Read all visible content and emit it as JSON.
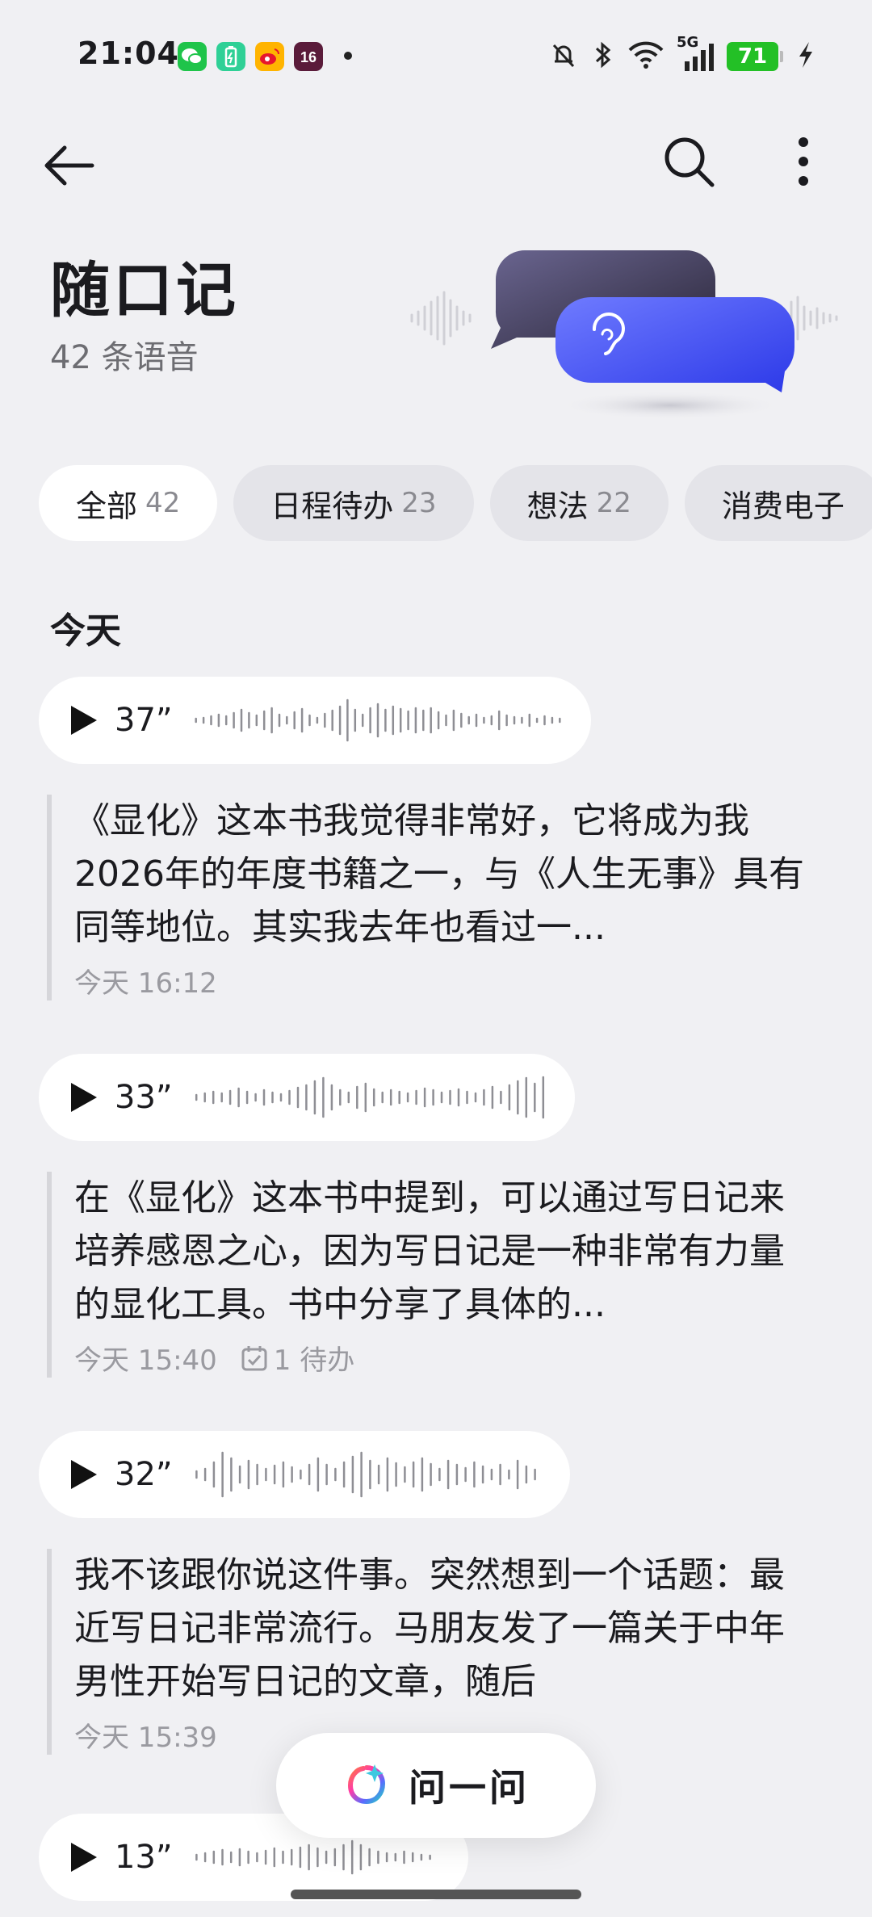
{
  "status_bar": {
    "time": "21:04",
    "apps": [
      "wechat-icon",
      "battery-saver-icon",
      "weibo-icon",
      "calendar-icon"
    ],
    "network": "5G",
    "battery": "71"
  },
  "toolbar": {
    "back_icon": "arrow-left-icon",
    "search_icon": "search-icon",
    "more_icon": "more-vertical-icon"
  },
  "header": {
    "title": "随口记",
    "subtitle": "42 条语音"
  },
  "filters": [
    {
      "label": "全部",
      "count": "42",
      "active": true
    },
    {
      "label": "日程待办",
      "count": "23",
      "active": false
    },
    {
      "label": "想法",
      "count": "22",
      "active": false
    },
    {
      "label": "消费电子",
      "count": "",
      "active": false
    }
  ],
  "section": {
    "title": "今天"
  },
  "entries": [
    {
      "duration": "37”",
      "text": "《显化》这本书我觉得非常好，它将成为我2026年的年度书籍之一，与《人生无事》具有同等地位。其实我去年也看过一...",
      "time": "今天 16:12",
      "todo": ""
    },
    {
      "duration": "33”",
      "text": "在《显化》这本书中提到，可以通过写日记来培养感恩之心，因为写日记是一种非常有力量的显化工具。书中分享了具体的...",
      "time": "今天 15:40",
      "todo": "1 待办"
    },
    {
      "duration": "32”",
      "text": "我不该跟你说这件事。突然想到一个话题：最近写日记非常流行。马朋友发了一篇关于中年男性开始写日记的文章，随后",
      "time": "今天 15:39",
      "todo": ""
    },
    {
      "duration": "13”",
      "text": "",
      "time": "",
      "todo": ""
    }
  ],
  "ask_button": {
    "label": "问一问"
  },
  "colors": {
    "background": "#f0f0f3",
    "accent_blue": "#3f4cf0",
    "battery_green": "#23c026"
  }
}
